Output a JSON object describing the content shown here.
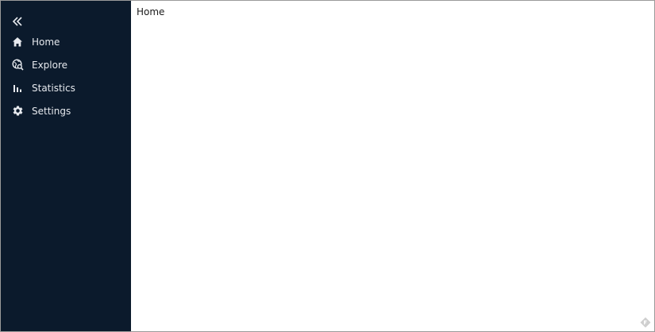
{
  "sidebar": {
    "collapse_icon": "chevrons-left-icon",
    "items": [
      {
        "label": "Home",
        "icon": "home-icon"
      },
      {
        "label": "Explore",
        "icon": "explore-icon"
      },
      {
        "label": "Statistics",
        "icon": "bar-chart-icon"
      },
      {
        "label": "Settings",
        "icon": "gear-icon"
      }
    ]
  },
  "main": {
    "title": "Home"
  },
  "colors": {
    "sidebar_bg": "#0b1a2c",
    "sidebar_text": "#e6e9ee",
    "main_bg": "#ffffff"
  }
}
